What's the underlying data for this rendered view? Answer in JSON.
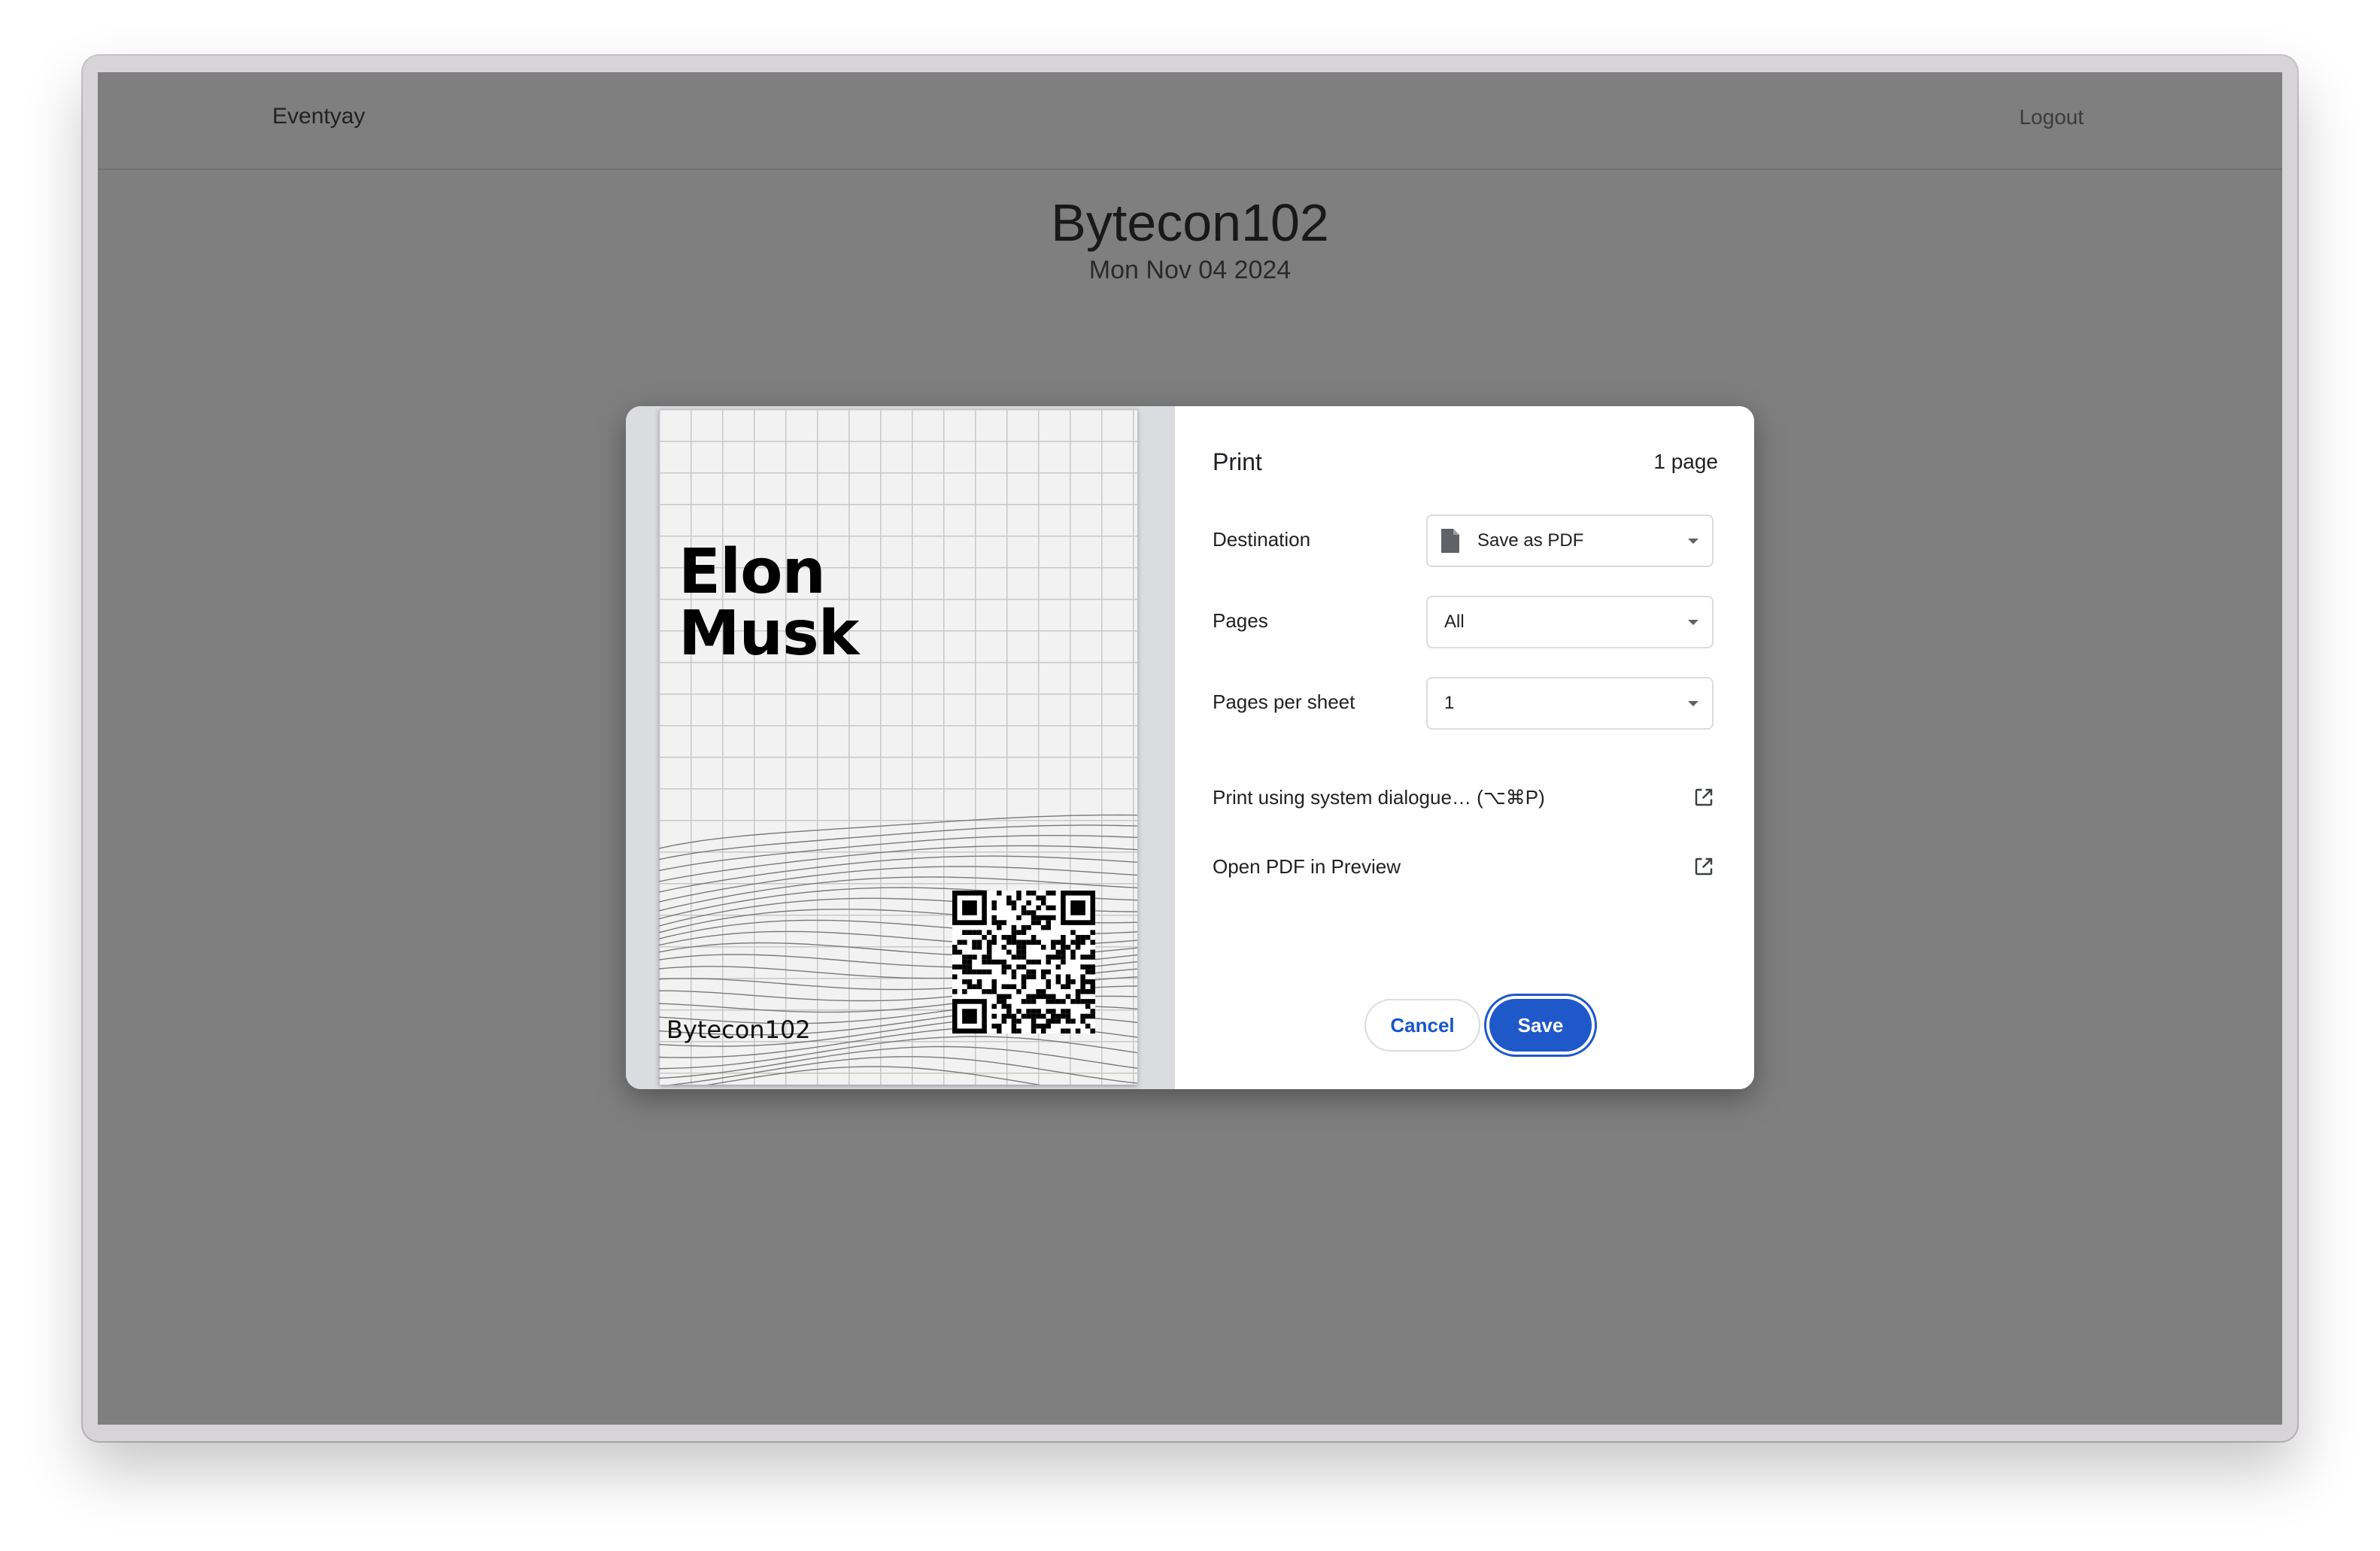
{
  "page": {
    "brand": "Eventyay",
    "logout_label": "Logout",
    "event_title": "Bytecon102",
    "event_date": "Mon Nov 04 2024"
  },
  "print_dialog": {
    "title": "Print",
    "page_count": "1 page",
    "destination": {
      "label": "Destination",
      "value": "Save as PDF",
      "icon": "document-icon"
    },
    "pages": {
      "label": "Pages",
      "value": "All"
    },
    "pages_per_sheet": {
      "label": "Pages per sheet",
      "value": "1"
    },
    "system_dialog_link": "Print using system dialogue… (⌥⌘P)",
    "open_pdf_link": "Open PDF in Preview",
    "cancel_label": "Cancel",
    "save_label": "Save",
    "accent_color": "#1f58c9"
  },
  "badge_preview": {
    "name_line1": "Elon",
    "name_line2": "Musk",
    "event_name": "Bytecon102"
  }
}
